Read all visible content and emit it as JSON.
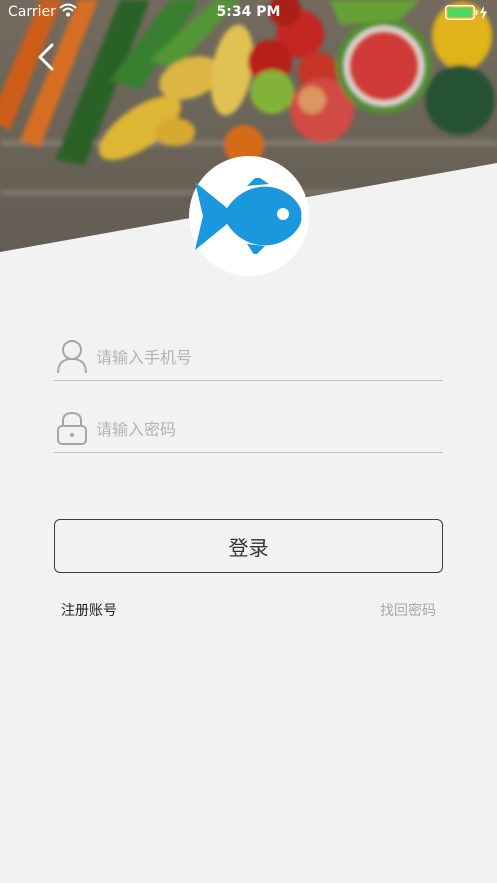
{
  "status_bar": {
    "carrier": "Carrier",
    "time": "5:34 PM"
  },
  "colors": {
    "brand_fish": "#1a97dd",
    "battery": "#4cd964",
    "background": "#f2f2f2"
  },
  "icons": {
    "back": "chevron-left-icon",
    "logo": "fish-icon",
    "phone_field": "user-icon",
    "password_field": "lock-icon"
  },
  "form": {
    "phone_placeholder": "请输入手机号",
    "password_placeholder": "请输入密码",
    "login_label": "登录"
  },
  "links": {
    "register": "注册账号",
    "forgot_password": "找回密码"
  }
}
